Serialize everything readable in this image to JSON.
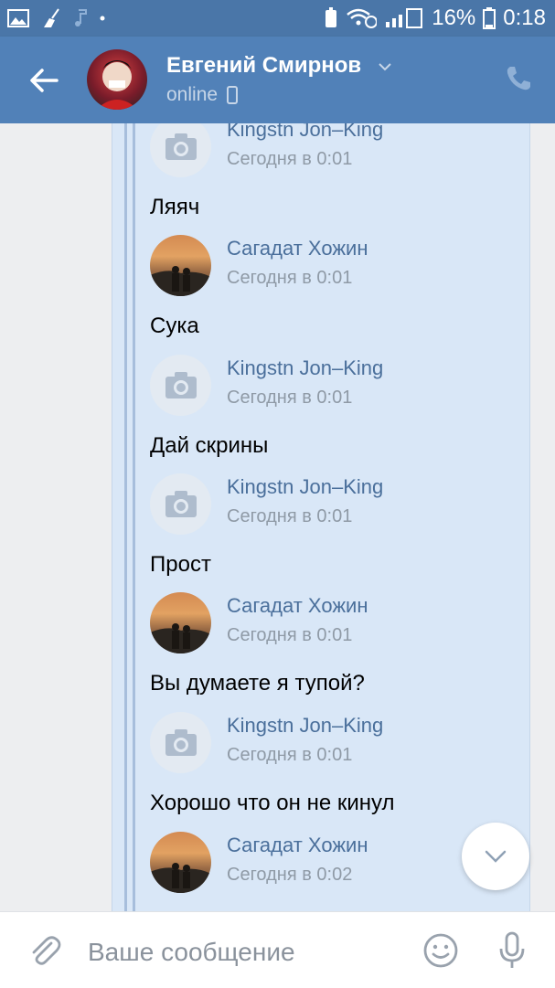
{
  "status_bar": {
    "battery": "16%",
    "time": "0:18"
  },
  "header": {
    "contact_name": "Евгений Смирнов",
    "status": "online"
  },
  "messages": [
    {
      "sender": "Kingstn Jon–King",
      "time": "Сегодня в 0:01",
      "text": "Ляяч",
      "avatar": "camera-placeholder"
    },
    {
      "sender": "Сагадат Хожин",
      "time": "Сегодня в 0:01",
      "text": "Сука",
      "avatar": "sunset-photo"
    },
    {
      "sender": "Kingstn Jon–King",
      "time": "Сегодня в 0:01",
      "text": "Дай скрины",
      "avatar": "camera-placeholder"
    },
    {
      "sender": "Kingstn Jon–King",
      "time": "Сегодня в 0:01",
      "text": "Прост",
      "avatar": "camera-placeholder"
    },
    {
      "sender": "Сагадат Хожин",
      "time": "Сегодня в 0:01",
      "text": "Вы думаете я тупой?",
      "avatar": "sunset-photo"
    },
    {
      "sender": "Kingstn Jon–King",
      "time": "Сегодня в 0:01",
      "text": "Хорошо что он не кинул",
      "avatar": "camera-placeholder"
    },
    {
      "sender": "Сагадат Хожин",
      "time": "Сегодня в 0:02",
      "text": "",
      "avatar": "sunset-photo"
    }
  ],
  "composer": {
    "placeholder": "Ваше сообщение"
  },
  "colors": {
    "header_bg": "#5181b8",
    "forward_bg": "#d9e7f7",
    "sender_name": "#4a6f9b"
  }
}
